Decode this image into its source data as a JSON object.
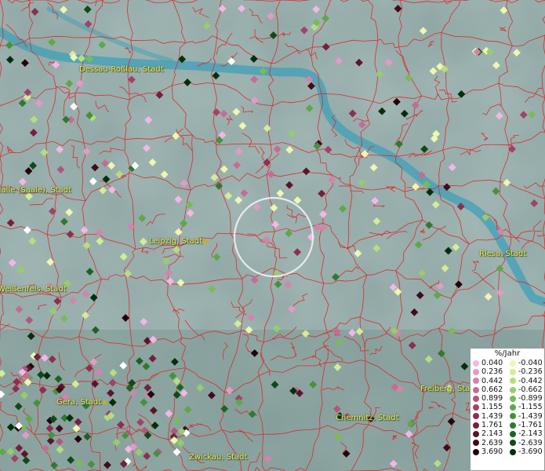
{
  "map": {
    "colors": {
      "background": "#8fa6a4",
      "river": "#3fa0b8",
      "borders": "#e02020"
    },
    "cities": [
      {
        "name": "Dessau-Roßlau, Stadt"
      },
      {
        "name": "Halle (Saale), Stadt"
      },
      {
        "name": "Leipzig, Stadt"
      },
      {
        "name": "Weißenfels, Stadt"
      },
      {
        "name": "Riesa, Stadt"
      },
      {
        "name": "Gera, Stadt"
      },
      {
        "name": "Chemnitz, Stadt"
      },
      {
        "name": "Freiberg, Stadt"
      },
      {
        "name": "Zwickau, Stadt"
      }
    ]
  },
  "legend": {
    "title": "%/Jahr",
    "positive": [
      {
        "label": "0.040",
        "color": "#f4b6e6"
      },
      {
        "label": "0.236",
        "color": "#e39ac8"
      },
      {
        "label": "0.442",
        "color": "#d483ad"
      },
      {
        "label": "0.662",
        "color": "#c46c94"
      },
      {
        "label": "0.899",
        "color": "#b3567c"
      },
      {
        "label": "1.155",
        "color": "#a14266"
      },
      {
        "label": "1.439",
        "color": "#8c2f51"
      },
      {
        "label": "1.761",
        "color": "#75203e"
      },
      {
        "label": "2.143",
        "color": "#5c142c"
      },
      {
        "label": "2.639",
        "color": "#420a1c"
      },
      {
        "label": "3.690",
        "color": "#26030c"
      }
    ],
    "negative": [
      {
        "label": "-0.040",
        "color": "#eef7b0"
      },
      {
        "label": "-0.236",
        "color": "#d3ec96"
      },
      {
        "label": "-0.442",
        "color": "#b5de7e"
      },
      {
        "label": "-0.662",
        "color": "#96cd6a"
      },
      {
        "label": "-0.899",
        "color": "#79bb58"
      },
      {
        "label": "-1.155",
        "color": "#5ea849"
      },
      {
        "label": "-1.439",
        "color": "#46923b"
      },
      {
        "label": "-1.761",
        "color": "#307a2e"
      },
      {
        "label": "-2.143",
        "color": "#1e6222"
      },
      {
        "label": "-2.639",
        "color": "#0f4a17"
      },
      {
        "label": "-3.690",
        "color": "#03300b"
      }
    ]
  }
}
